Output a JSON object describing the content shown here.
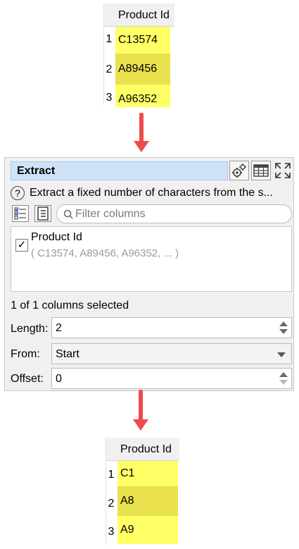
{
  "input_table": {
    "header": "Product Id",
    "rows": [
      {
        "n": "1",
        "value": "C13574"
      },
      {
        "n": "2",
        "value": "A89456"
      },
      {
        "n": "3",
        "value": "A96352"
      }
    ]
  },
  "transform": {
    "title": "Extract",
    "buttons": {
      "options_icon": "gear-icon",
      "table_icon": "table-icon",
      "maximize_icon": "expand-icon"
    },
    "help_text": "Extract a fixed number of characters from the s...",
    "filter_placeholder": "Filter columns",
    "columns": [
      {
        "name": "Product Id",
        "checked": true,
        "sample": "( C13574, A89456, A96352, ... )"
      }
    ],
    "selection_count": "1 of 1 columns selected",
    "length": {
      "label": "Length:",
      "value": "2"
    },
    "from": {
      "label": "From:",
      "value": "Start"
    },
    "offset": {
      "label": "Offset:",
      "value": "0"
    }
  },
  "output_table": {
    "header": "Product Id",
    "rows": [
      {
        "n": "1",
        "value": "C1"
      },
      {
        "n": "2",
        "value": "A8"
      },
      {
        "n": "3",
        "value": "A9"
      }
    ]
  },
  "colors": {
    "arrow": "#f04a4d",
    "cell_highlight": "#ffff66",
    "cell_highlight_alt": "#e8e14d",
    "title_bg": "#cfe3f8"
  }
}
